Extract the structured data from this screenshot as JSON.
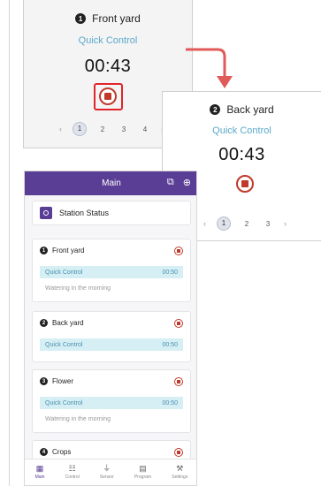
{
  "front_card": {
    "zone_number": "1",
    "zone_name": "Front yard",
    "mode": "Quick Control",
    "time": "00:43",
    "pages": [
      "1",
      "2",
      "3",
      "4"
    ],
    "prev": "‹",
    "next": "›"
  },
  "back_card": {
    "zone_number": "2",
    "zone_name": "Back yard",
    "mode": "Quick Control",
    "time": "00:43",
    "pages": [
      "1",
      "2",
      "3"
    ],
    "prev": "‹",
    "next": "›"
  },
  "phone": {
    "title": "Main",
    "status_title": "Station Status",
    "zones": [
      {
        "number": "1",
        "name": "Front yard",
        "mode": "Quick Control",
        "time": "00:50",
        "note": "Watering in the morning"
      },
      {
        "number": "2",
        "name": "Back yard",
        "mode": "Quick Control",
        "time": "00:50",
        "note": ""
      },
      {
        "number": "3",
        "name": "Flower",
        "mode": "Quick Control",
        "time": "00:50",
        "note": "Watering in the morning"
      },
      {
        "number": "4",
        "name": "Crops",
        "mode": "",
        "time": "",
        "note": ""
      }
    ],
    "tabs": [
      {
        "icon": "grid-icon",
        "glyph": "▦",
        "label": "Main"
      },
      {
        "icon": "list-icon",
        "glyph": "☷",
        "label": "Control"
      },
      {
        "icon": "sensor-icon",
        "glyph": "⏚",
        "label": "Sensor"
      },
      {
        "icon": "calendar-icon",
        "glyph": "▤",
        "label": "Program"
      },
      {
        "icon": "tools-icon",
        "glyph": "⚒",
        "label": "Settings"
      }
    ]
  },
  "colors": {
    "accent": "#5a3d95",
    "stop": "#c0392b",
    "highlight": "#e0242b",
    "quick_control": "#5aa9c9"
  }
}
